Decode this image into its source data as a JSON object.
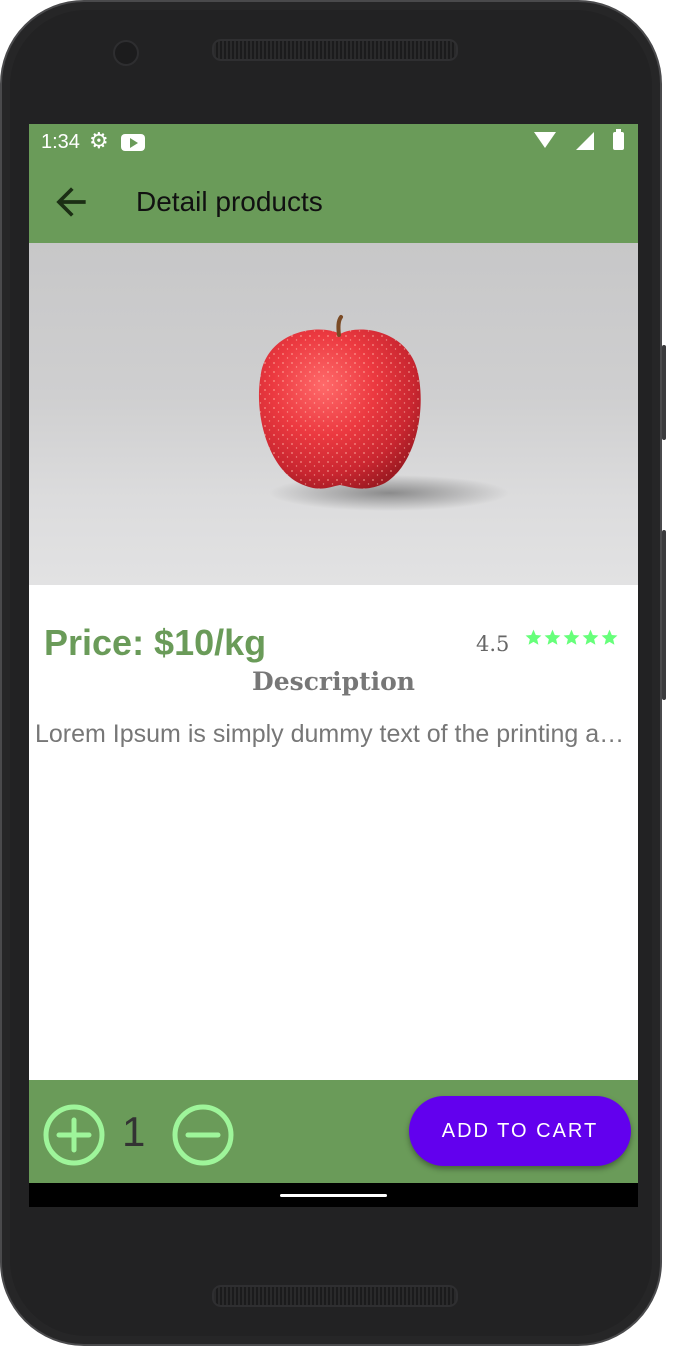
{
  "status_bar": {
    "time": "1:34",
    "icons": [
      "gear-icon",
      "youtube-icon",
      "wifi-icon",
      "signal-icon",
      "battery-icon"
    ]
  },
  "app_bar": {
    "title": "Detail products",
    "back_icon": "arrow-back-icon"
  },
  "product": {
    "image": "red-apple",
    "price": "Price: $10/kg",
    "rating": "4.5",
    "stars": 5,
    "description_heading": "Description",
    "description": "Lorem Ipsum is simply dummy text of the printing and typesetting industry."
  },
  "cart": {
    "quantity": "1",
    "add_label": "ADD TO CART",
    "plus_icon": "add-circle-icon",
    "minus_icon": "remove-circle-icon"
  },
  "colors": {
    "primary": "#6a9b59",
    "accent_button": "#6200ee",
    "star": "#66ff7a",
    "qty_icon": "#9ef59a"
  }
}
